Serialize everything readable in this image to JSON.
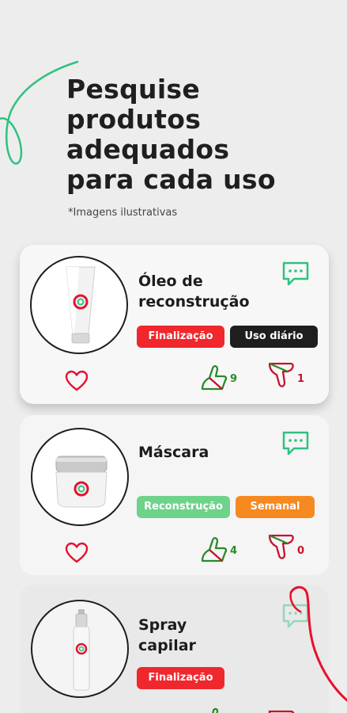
{
  "headline": {
    "line1": "Pesquise",
    "line2": "produtos",
    "line3": "adequados",
    "line4": "para cada uso"
  },
  "note": "*Imagens ilustrativas",
  "colors": {
    "accent_green": "#2ec27e",
    "accent_red": "#e8102f",
    "tag_red": "#f0272c",
    "tag_black": "#1e1e1e",
    "tag_green": "#6ed28b",
    "tag_orange": "#f6891f"
  },
  "products": [
    {
      "name_line1": "Óleo de",
      "name_line2": "reconstrução",
      "tags": [
        "Finalização",
        "Uso diário"
      ],
      "likes": "9",
      "dislikes": "1",
      "image": "tube-icon"
    },
    {
      "name_line1": "Máscara",
      "name_line2": "",
      "tags": [
        "Reconstrução",
        "Semanal"
      ],
      "likes": "4",
      "dislikes": "0",
      "image": "jar-icon"
    },
    {
      "name_line1": "Spray",
      "name_line2": "capilar",
      "tags": [
        "Finalização"
      ],
      "image": "spray-bottle-icon"
    }
  ]
}
